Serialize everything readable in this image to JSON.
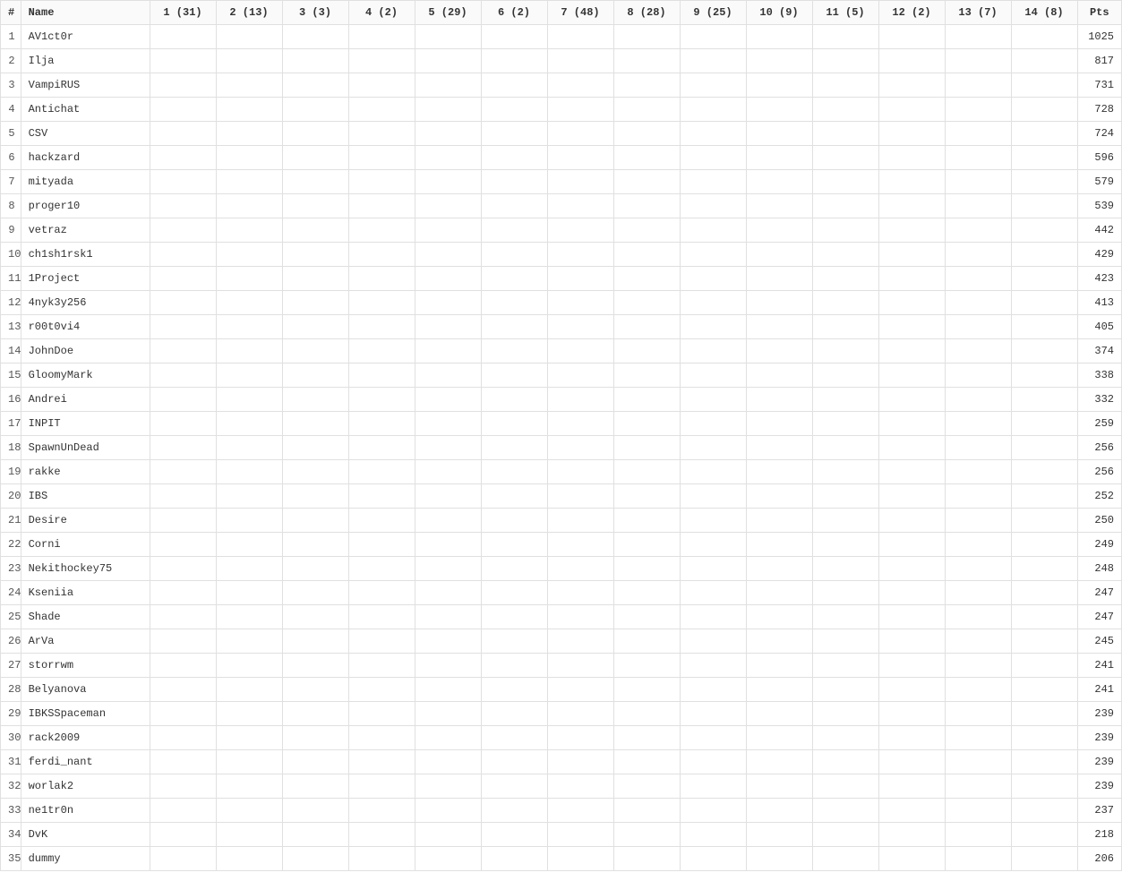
{
  "table": {
    "headers": {
      "rank": "#",
      "name": "Name",
      "tasks": [
        "1 (31)",
        "2 (13)",
        "3 (3)",
        "4 (2)",
        "5 (29)",
        "6 (2)",
        "7 (48)",
        "8 (28)",
        "9 (25)",
        "10 (9)",
        "11 (5)",
        "12 (2)",
        "13 (7)",
        "14 (8)"
      ],
      "pts": "Pts"
    },
    "rows": [
      {
        "rank": "1",
        "name": "AV1ct0r",
        "pts": "1025"
      },
      {
        "rank": "2",
        "name": "Ilja",
        "pts": "817"
      },
      {
        "rank": "3",
        "name": "VampiRUS",
        "pts": "731"
      },
      {
        "rank": "4",
        "name": "Antichat",
        "pts": "728"
      },
      {
        "rank": "5",
        "name": "CSV",
        "pts": "724"
      },
      {
        "rank": "6",
        "name": "hackzard",
        "pts": "596"
      },
      {
        "rank": "7",
        "name": "mityada",
        "pts": "579"
      },
      {
        "rank": "8",
        "name": "proger10",
        "pts": "539"
      },
      {
        "rank": "9",
        "name": "vetraz",
        "pts": "442"
      },
      {
        "rank": "10",
        "name": "ch1sh1rsk1",
        "pts": "429"
      },
      {
        "rank": "11",
        "name": "1Project",
        "pts": "423"
      },
      {
        "rank": "12",
        "name": "4nyk3y256",
        "pts": "413"
      },
      {
        "rank": "13",
        "name": "r00t0vi4",
        "pts": "405"
      },
      {
        "rank": "14",
        "name": "JohnDoe",
        "pts": "374"
      },
      {
        "rank": "15",
        "name": "GloomyMark",
        "pts": "338"
      },
      {
        "rank": "16",
        "name": "Andrei",
        "pts": "332"
      },
      {
        "rank": "17",
        "name": "INPIT",
        "pts": "259"
      },
      {
        "rank": "18",
        "name": "SpawnUnDead",
        "pts": "256"
      },
      {
        "rank": "19",
        "name": "rakke",
        "pts": "256"
      },
      {
        "rank": "20",
        "name": "IBS",
        "pts": "252"
      },
      {
        "rank": "21",
        "name": "Desire",
        "pts": "250"
      },
      {
        "rank": "22",
        "name": "Corni",
        "pts": "249"
      },
      {
        "rank": "23",
        "name": "Nekithockey75",
        "pts": "248"
      },
      {
        "rank": "24",
        "name": "Kseniia",
        "pts": "247"
      },
      {
        "rank": "25",
        "name": "Shade",
        "pts": "247"
      },
      {
        "rank": "26",
        "name": "ArVa",
        "pts": "245"
      },
      {
        "rank": "27",
        "name": "storrwm",
        "pts": "241"
      },
      {
        "rank": "28",
        "name": "Belyanova",
        "pts": "241"
      },
      {
        "rank": "29",
        "name": "IBKSSpaceman",
        "pts": "239"
      },
      {
        "rank": "30",
        "name": "rack2009",
        "pts": "239"
      },
      {
        "rank": "31",
        "name": "ferdi_nant",
        "pts": "239"
      },
      {
        "rank": "32",
        "name": "worlak2",
        "pts": "239"
      },
      {
        "rank": "33",
        "name": "ne1tr0n",
        "pts": "237"
      },
      {
        "rank": "34",
        "name": "DvK",
        "pts": "218"
      },
      {
        "rank": "35",
        "name": "dummy",
        "pts": "206"
      }
    ]
  }
}
